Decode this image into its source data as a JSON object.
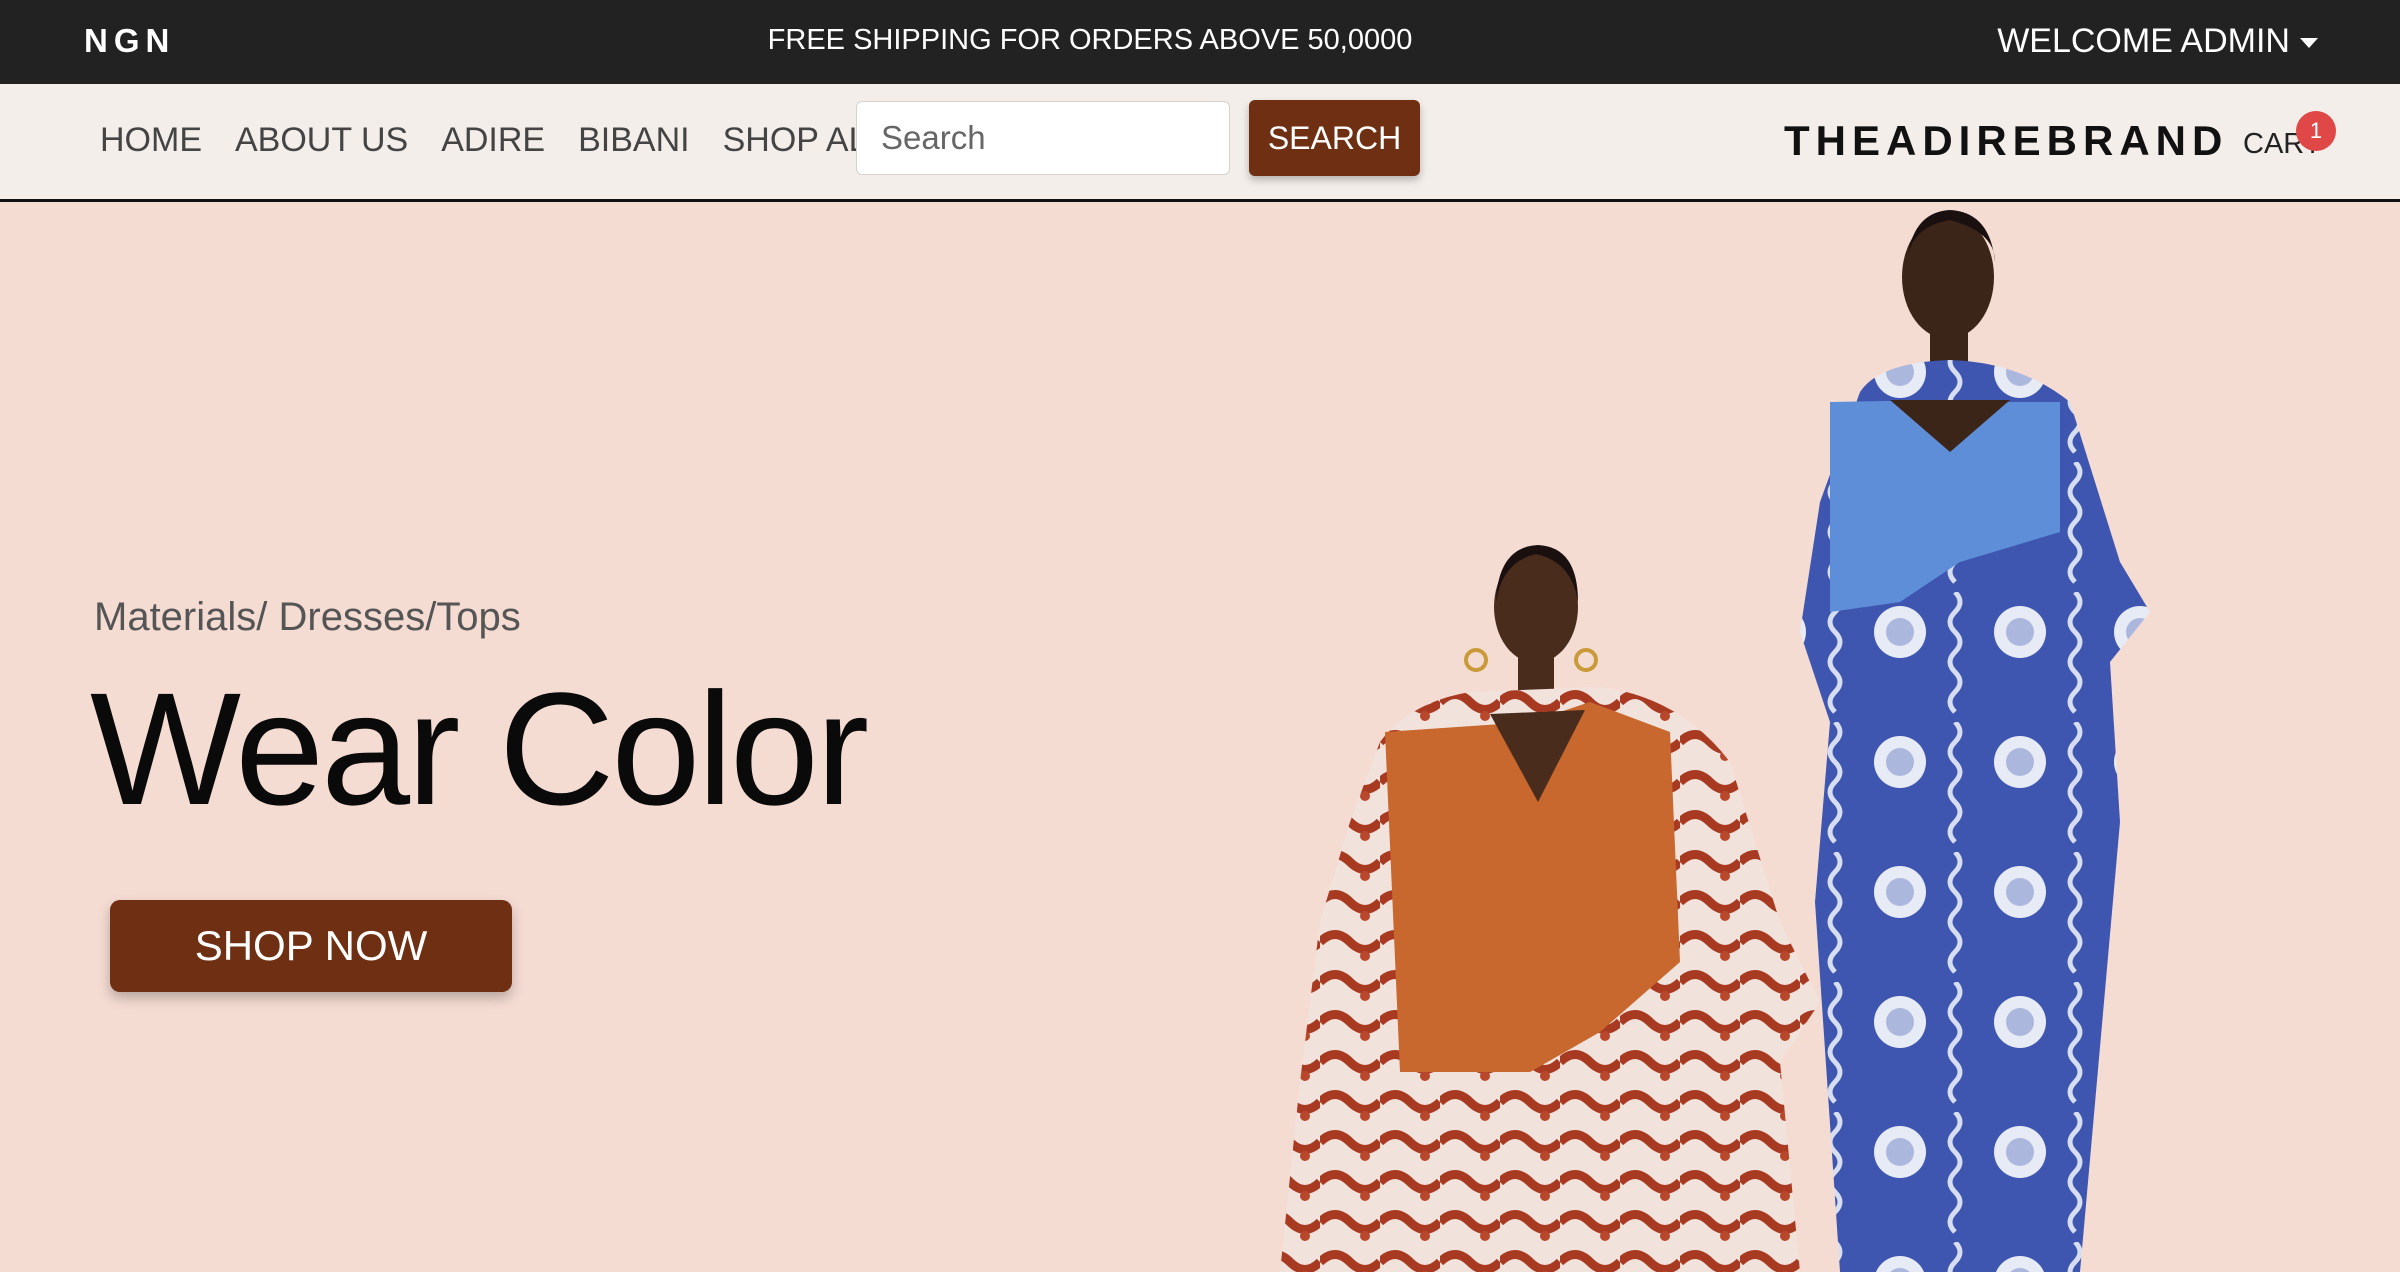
{
  "topbar": {
    "currency": "NGN",
    "promo": "FREE SHIPPING FOR ORDERS ABOVE 50,0000",
    "welcome": "WELCOME ADMIN"
  },
  "nav": {
    "links": [
      "HOME",
      "ABOUT US",
      "ADIRE",
      "BIBANI",
      "SHOP ALL"
    ],
    "search_placeholder": "Search",
    "search_button": "SEARCH",
    "brand": "THEADIREBRAND",
    "cart_label": "CART",
    "cart_count": "1"
  },
  "hero": {
    "categories": "Materials/ Dresses/Tops",
    "headline": "Wear Color",
    "cta": "SHOP NOW"
  },
  "colors": {
    "topbar_bg": "#222222",
    "navbar_bg": "#f3eeea",
    "hero_bg": "#f5dcd3",
    "accent_brown": "#6e2f12",
    "badge_red": "#e04848",
    "dress_orange": "#c8672e",
    "dress_blue": "#3f5bb5"
  },
  "icons": [
    "chevron-down-icon"
  ]
}
